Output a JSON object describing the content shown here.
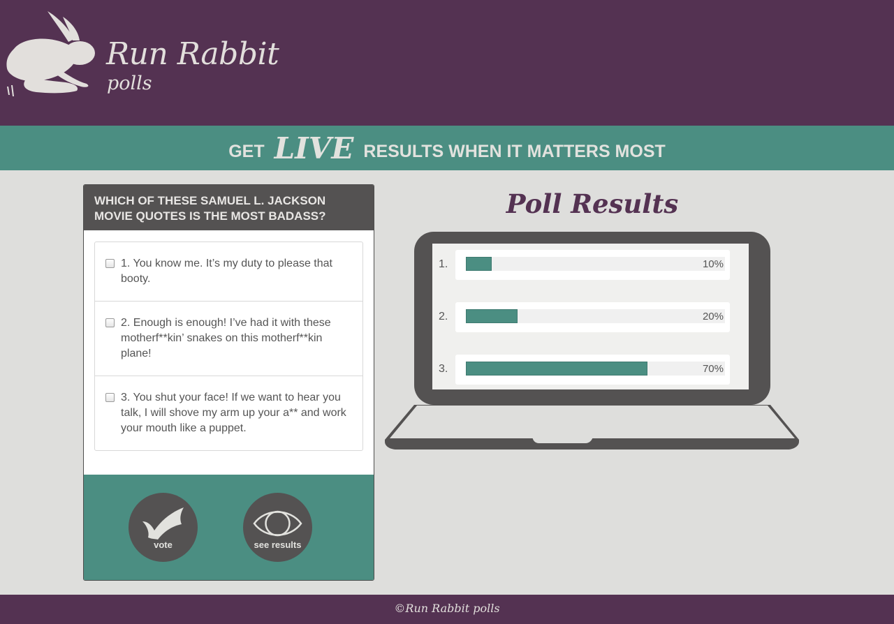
{
  "brand": {
    "title": "Run Rabbit",
    "subtitle": "polls",
    "logo_icon": "rabbit-icon"
  },
  "banner": {
    "pre": "GET",
    "emphasis": "LIVE",
    "post": "RESULTS WHEN IT MATTERS MOST"
  },
  "poll": {
    "question": "Which of these Samuel L. Jackson movie quotes is the most badass?",
    "options": [
      {
        "label": "1. You know me. It’s my duty to please that booty.",
        "checked": false
      },
      {
        "label": "2. Enough is enough! I’ve had it with these motherf**kin’ snakes on this motherf**kin plane!",
        "checked": false
      },
      {
        "label": "3. You shut your face! If we want to hear you talk, I will shove my arm up your a** and work your mouth like a puppet.",
        "checked": false
      }
    ],
    "vote_label": "vote",
    "vote_icon": "checkmark-icon",
    "results_label": "see results",
    "results_icon": "eye-icon"
  },
  "results": {
    "title": "Poll Results",
    "rows": [
      {
        "num": "1.",
        "percent": 10,
        "label": "10%"
      },
      {
        "num": "2.",
        "percent": 20,
        "label": "20%"
      },
      {
        "num": "3.",
        "percent": 70,
        "label": "70%"
      }
    ]
  },
  "footer": {
    "text": "©Run Rabbit polls"
  },
  "colors": {
    "purple": "#543252",
    "teal": "#4b8e82",
    "dark_gray": "#545252",
    "background": "#dededc"
  }
}
